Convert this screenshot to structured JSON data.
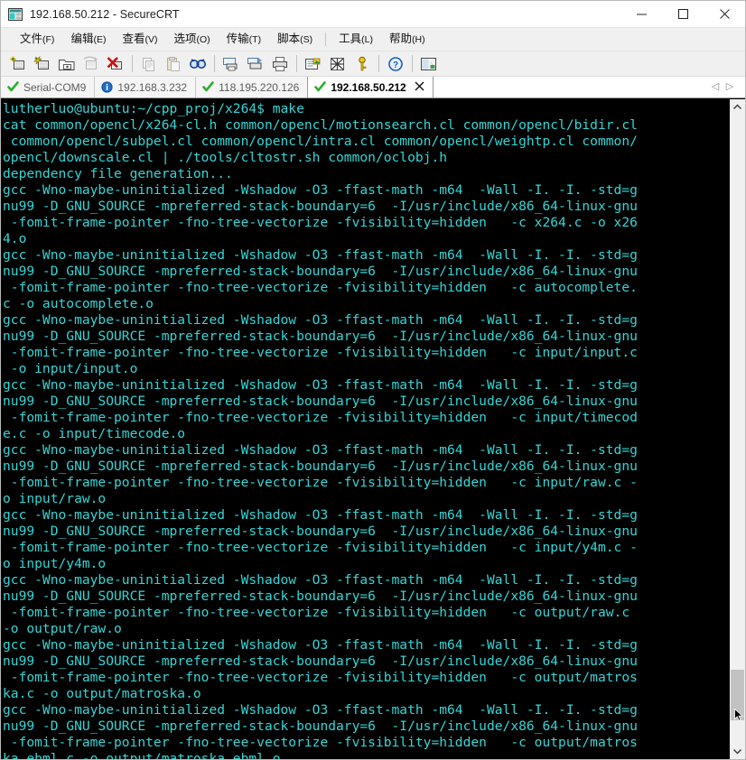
{
  "window": {
    "title": "192.168.50.212 - SecureCRT",
    "app_icon": "securecrt-icon",
    "minimize_label": "—",
    "maximize_label": "□",
    "close_label": "✕"
  },
  "menubar": {
    "items": [
      {
        "name": "file",
        "label": "文件",
        "accel": "(F)"
      },
      {
        "name": "edit",
        "label": "编辑",
        "accel": "(E)"
      },
      {
        "name": "view",
        "label": "查看",
        "accel": "(V)"
      },
      {
        "name": "options",
        "label": "选项",
        "accel": "(O)"
      },
      {
        "name": "transfer",
        "label": "传输",
        "accel": "(T)"
      },
      {
        "name": "script",
        "label": "脚本",
        "accel": "(S)"
      },
      {
        "name": "tools",
        "label": "工具",
        "accel": "(L)"
      },
      {
        "name": "help",
        "label": "帮助",
        "accel": "(H)"
      }
    ]
  },
  "toolbar": {
    "buttons": [
      "new-session-icon",
      "quick-connect-icon",
      "connect-in-tab-icon",
      "reconnect-icon",
      "disconnect-icon",
      "copy-icon",
      "paste-icon",
      "find-icon",
      "print-screen-icon",
      "log-session-icon",
      "print-icon",
      "session-options-icon",
      "toggle-raw-icon",
      "key-icon",
      "help-icon",
      "session-manager-icon"
    ]
  },
  "tabs": [
    {
      "label": "Serial-COM9",
      "icon": "check-icon",
      "active": false,
      "closable": false
    },
    {
      "label": "192.168.3.232",
      "icon": "info-icon",
      "active": false,
      "closable": false
    },
    {
      "label": "118.195.220.126",
      "icon": "check-icon",
      "active": false,
      "closable": false
    },
    {
      "label": "192.168.50.212",
      "icon": "check-icon",
      "active": true,
      "closable": true
    }
  ],
  "tab_nav": {
    "prev": "◁",
    "next": "▷"
  },
  "terminal": {
    "foreground": "#35d6d6",
    "background": "#000000",
    "prompt": "lutherluo@ubuntu:~/cpp_proj/x264$",
    "command": "make",
    "lines": [
      "lutherluo@ubuntu:~/cpp_proj/x264$ make",
      "cat common/opencl/x264-cl.h common/opencl/motionsearch.cl common/opencl/bidir.cl",
      " common/opencl/subpel.cl common/opencl/intra.cl common/opencl/weightp.cl common/",
      "opencl/downscale.cl | ./tools/cltostr.sh common/oclobj.h",
      "dependency file generation...",
      "gcc -Wno-maybe-uninitialized -Wshadow -O3 -ffast-math -m64  -Wall -I. -I. -std=g",
      "nu99 -D_GNU_SOURCE -mpreferred-stack-boundary=6  -I/usr/include/x86_64-linux-gnu",
      " -fomit-frame-pointer -fno-tree-vectorize -fvisibility=hidden   -c x264.c -o x26",
      "4.o",
      "gcc -Wno-maybe-uninitialized -Wshadow -O3 -ffast-math -m64  -Wall -I. -I. -std=g",
      "nu99 -D_GNU_SOURCE -mpreferred-stack-boundary=6  -I/usr/include/x86_64-linux-gnu",
      " -fomit-frame-pointer -fno-tree-vectorize -fvisibility=hidden   -c autocomplete.",
      "c -o autocomplete.o",
      "gcc -Wno-maybe-uninitialized -Wshadow -O3 -ffast-math -m64  -Wall -I. -I. -std=g",
      "nu99 -D_GNU_SOURCE -mpreferred-stack-boundary=6  -I/usr/include/x86_64-linux-gnu",
      " -fomit-frame-pointer -fno-tree-vectorize -fvisibility=hidden   -c input/input.c",
      " -o input/input.o",
      "gcc -Wno-maybe-uninitialized -Wshadow -O3 -ffast-math -m64  -Wall -I. -I. -std=g",
      "nu99 -D_GNU_SOURCE -mpreferred-stack-boundary=6  -I/usr/include/x86_64-linux-gnu",
      " -fomit-frame-pointer -fno-tree-vectorize -fvisibility=hidden   -c input/timecod",
      "e.c -o input/timecode.o",
      "gcc -Wno-maybe-uninitialized -Wshadow -O3 -ffast-math -m64  -Wall -I. -I. -std=g",
      "nu99 -D_GNU_SOURCE -mpreferred-stack-boundary=6  -I/usr/include/x86_64-linux-gnu",
      " -fomit-frame-pointer -fno-tree-vectorize -fvisibility=hidden   -c input/raw.c -",
      "o input/raw.o",
      "gcc -Wno-maybe-uninitialized -Wshadow -O3 -ffast-math -m64  -Wall -I. -I. -std=g",
      "nu99 -D_GNU_SOURCE -mpreferred-stack-boundary=6  -I/usr/include/x86_64-linux-gnu",
      " -fomit-frame-pointer -fno-tree-vectorize -fvisibility=hidden   -c input/y4m.c -",
      "o input/y4m.o",
      "gcc -Wno-maybe-uninitialized -Wshadow -O3 -ffast-math -m64  -Wall -I. -I. -std=g",
      "nu99 -D_GNU_SOURCE -mpreferred-stack-boundary=6  -I/usr/include/x86_64-linux-gnu",
      " -fomit-frame-pointer -fno-tree-vectorize -fvisibility=hidden   -c output/raw.c",
      "-o output/raw.o",
      "gcc -Wno-maybe-uninitialized -Wshadow -O3 -ffast-math -m64  -Wall -I. -I. -std=g",
      "nu99 -D_GNU_SOURCE -mpreferred-stack-boundary=6  -I/usr/include/x86_64-linux-gnu",
      " -fomit-frame-pointer -fno-tree-vectorize -fvisibility=hidden   -c output/matros",
      "ka.c -o output/matroska.o",
      "gcc -Wno-maybe-uninitialized -Wshadow -O3 -ffast-math -m64  -Wall -I. -I. -std=g",
      "nu99 -D_GNU_SOURCE -mpreferred-stack-boundary=6  -I/usr/include/x86_64-linux-gnu",
      " -fomit-frame-pointer -fno-tree-vectorize -fvisibility=hidden   -c output/matros",
      "ka_ebml.c -o output/matroska_ebml.o"
    ]
  },
  "scrollbar": {
    "up_arrow": "▲",
    "down_arrow": "▼"
  }
}
